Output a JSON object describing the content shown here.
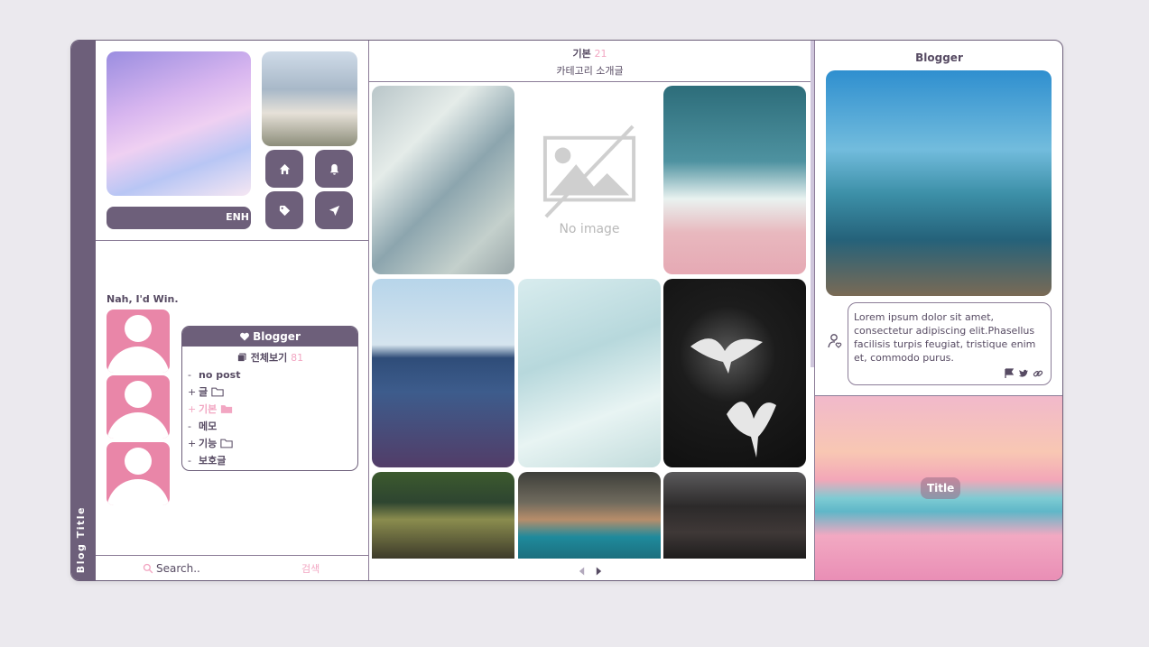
{
  "blog": {
    "title": "Blog Title"
  },
  "profile": {
    "lang_label": "ENH",
    "greeting": "Nah, I'd Win.",
    "icons": [
      "home-icon",
      "bell-icon",
      "tag-icon",
      "paper-plane-icon"
    ]
  },
  "category_box": {
    "header": "Blogger",
    "all_label": "전체보기",
    "all_count": "81",
    "items": [
      {
        "prefix": "-",
        "label": "no post",
        "folder": false,
        "active": false
      },
      {
        "prefix": "+",
        "label": "글",
        "folder": true,
        "active": false
      },
      {
        "prefix": "+",
        "label": "기본",
        "folder": true,
        "active": true
      },
      {
        "prefix": "-",
        "label": "메모",
        "folder": false,
        "active": false
      },
      {
        "prefix": "+",
        "label": "기능",
        "folder": true,
        "active": false
      },
      {
        "prefix": "-",
        "label": "보호글",
        "folder": false,
        "active": false
      }
    ]
  },
  "search": {
    "placeholder": "Search..",
    "button": "검색"
  },
  "category_header": {
    "name": "기본",
    "count": "21",
    "description": "카테고리 소개글"
  },
  "grid": {
    "no_image_label": "No image"
  },
  "sidebar_right": {
    "title": "Blogger",
    "quote": "Lorem ipsum dolor sit amet, consectetur adipiscing elit.Phasellus facilisis turpis feugiat, tristique enim et, commodo purus.",
    "title_chip": "Title"
  },
  "colors": {
    "accent": "#6d5f7a",
    "pink": "#f2a6c2",
    "avatar": "#e986a8"
  }
}
